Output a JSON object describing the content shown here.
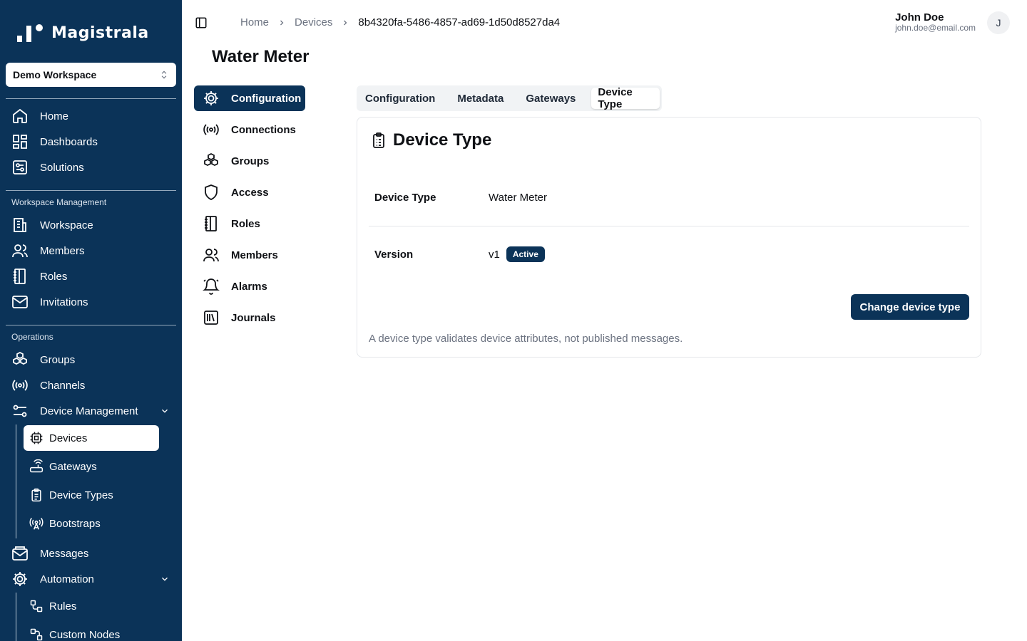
{
  "app": {
    "name": "Magistrala",
    "workspace": "Demo Workspace"
  },
  "sidebar": {
    "top_items": [
      {
        "label": "Home",
        "icon": "home-icon"
      },
      {
        "label": "Dashboards",
        "icon": "dashboards-icon"
      },
      {
        "label": "Solutions",
        "icon": "solutions-icon"
      }
    ],
    "workspace_section": "Workspace Management",
    "workspace_items": [
      {
        "label": "Workspace",
        "icon": "building-icon"
      },
      {
        "label": "Members",
        "icon": "users-icon"
      },
      {
        "label": "Roles",
        "icon": "notebook-icon"
      },
      {
        "label": "Invitations",
        "icon": "mail-icon"
      }
    ],
    "operations_section": "Operations",
    "operations_items": [
      {
        "label": "Groups",
        "icon": "boxes-icon"
      },
      {
        "label": "Channels",
        "icon": "broadcast-icon"
      },
      {
        "label": "Device Management",
        "icon": "sliders-icon"
      }
    ],
    "device_sub_items": [
      {
        "label": "Devices",
        "icon": "chip-icon",
        "active": true
      },
      {
        "label": "Gateways",
        "icon": "router-icon"
      },
      {
        "label": "Device Types",
        "icon": "clipboard-icon"
      },
      {
        "label": "Bootstraps",
        "icon": "antenna-icon"
      }
    ],
    "messages": {
      "label": "Messages",
      "icon": "mail-open-icon"
    },
    "automation": {
      "label": "Automation",
      "icon": "gear-icon"
    },
    "automation_sub_items": [
      {
        "label": "Rules",
        "icon": "workflow-icon"
      },
      {
        "label": "Custom Nodes",
        "icon": "nodes-icon"
      }
    ]
  },
  "header": {
    "breadcrumb": [
      "Home",
      "Devices",
      "8b4320fa-5486-4857-ad69-1d50d8527da4"
    ],
    "user_name": "John Doe",
    "user_email": "john.doe@email.com",
    "avatar_initial": "J"
  },
  "page": {
    "title": "Water Meter"
  },
  "inner_nav": [
    {
      "label": "Configuration",
      "icon": "gear-icon",
      "active": true
    },
    {
      "label": "Connections",
      "icon": "broadcast-icon"
    },
    {
      "label": "Groups",
      "icon": "boxes-icon"
    },
    {
      "label": "Access",
      "icon": "shield-icon"
    },
    {
      "label": "Roles",
      "icon": "notebook-icon"
    },
    {
      "label": "Members",
      "icon": "users-icon"
    },
    {
      "label": "Alarms",
      "icon": "bell-icon"
    },
    {
      "label": "Journals",
      "icon": "library-icon"
    }
  ],
  "tabs": [
    {
      "label": "Configuration"
    },
    {
      "label": "Metadata"
    },
    {
      "label": "Gateways"
    },
    {
      "label": "Device Type",
      "active": true
    }
  ],
  "card": {
    "title": "Device Type",
    "device_type_label": "Device Type",
    "device_type_value": "Water Meter",
    "version_label": "Version",
    "version_value": "v1",
    "version_status": "Active",
    "change_button": "Change device type",
    "hint": "A device type validates device attributes, not published messages."
  },
  "colors": {
    "sidebar_bg": "#0b3358",
    "primary": "#0b3358",
    "muted_text": "#6b7280"
  }
}
